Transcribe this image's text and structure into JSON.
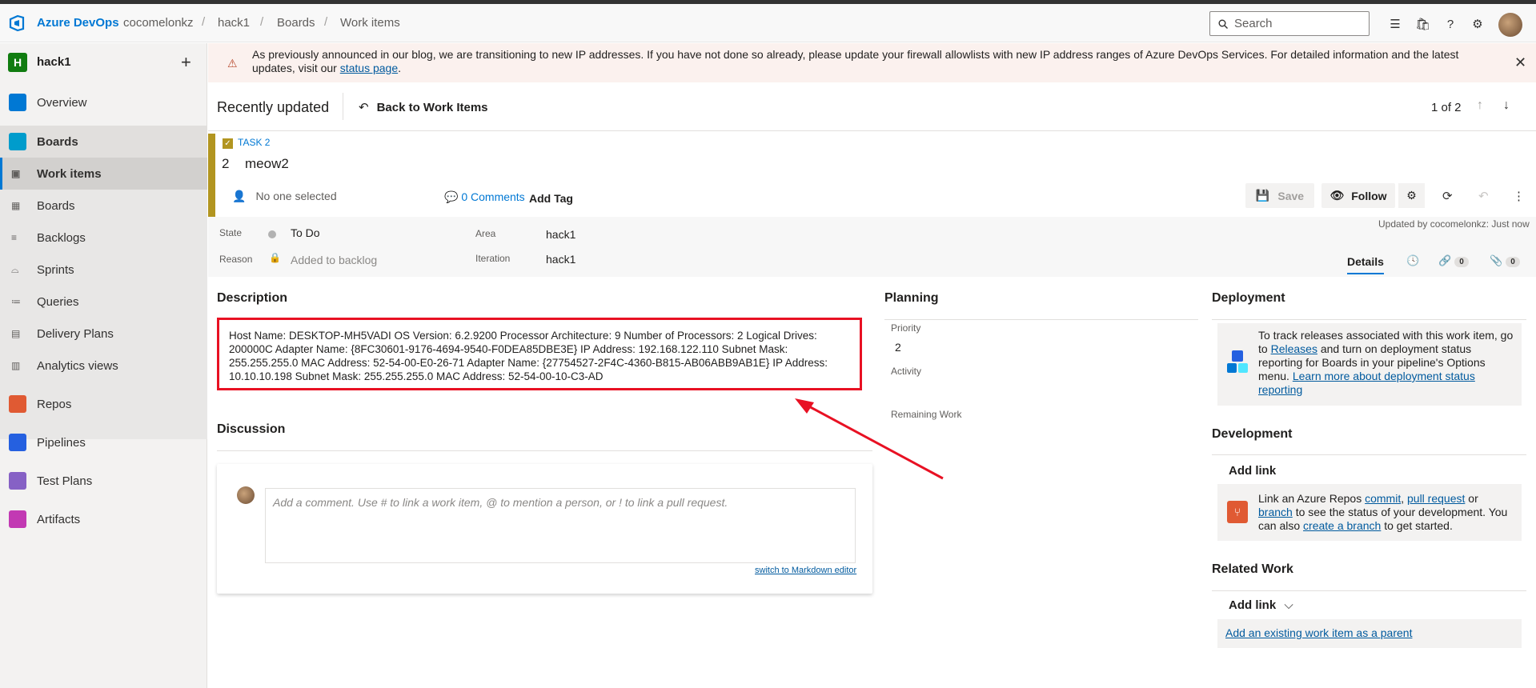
{
  "header": {
    "brand": "Azure DevOps",
    "breadcrumbs": [
      "cocomelonkz",
      "hack1",
      "Boards",
      "Work items"
    ],
    "search_placeholder": "Search"
  },
  "sidebar": {
    "project_initial": "H",
    "project_name": "hack1",
    "items": [
      {
        "label": "Overview",
        "icon": "overview-icon",
        "color": "#0078d4"
      },
      {
        "label": "Boards",
        "icon": "boards-icon",
        "color": "#009ccc"
      },
      {
        "label": "Work items",
        "icon": "work-items-icon"
      },
      {
        "label": "Boards",
        "icon": "board-icon"
      },
      {
        "label": "Backlogs",
        "icon": "backlogs-icon"
      },
      {
        "label": "Sprints",
        "icon": "sprints-icon"
      },
      {
        "label": "Queries",
        "icon": "queries-icon"
      },
      {
        "label": "Delivery Plans",
        "icon": "delivery-plans-icon"
      },
      {
        "label": "Analytics views",
        "icon": "analytics-icon"
      },
      {
        "label": "Repos",
        "icon": "repos-icon",
        "color": "#e05a33"
      },
      {
        "label": "Pipelines",
        "icon": "pipelines-icon",
        "color": "#2560e0"
      },
      {
        "label": "Test Plans",
        "icon": "test-plans-icon",
        "color": "#8661c5"
      },
      {
        "label": "Artifacts",
        "icon": "artifacts-icon",
        "color": "#c239b3"
      }
    ]
  },
  "banner": {
    "text": "As previously announced in our blog, we are transitioning to new IP addresses. If you have not done so already, please update your firewall allowlists with new IP address ranges of Azure DevOps Services. For detailed information and the latest updates, visit our ",
    "link": "status page",
    "suffix": "."
  },
  "toolbar": {
    "recent": "Recently updated",
    "back": "Back to Work Items",
    "pager": "1 of 2"
  },
  "work_item": {
    "type": "TASK 2",
    "id": "2",
    "title": "meow2",
    "assigned": "No one selected",
    "comments": "0 Comments",
    "add_tag": "Add Tag",
    "save": "Save",
    "follow": "Follow",
    "updated": "Updated by cocomelonkz: Just now",
    "state_label": "State",
    "state": "To Do",
    "reason_label": "Reason",
    "reason": "Added to backlog",
    "area_label": "Area",
    "area": "hack1",
    "iteration_label": "Iteration",
    "iteration": "hack1",
    "tab_details": "Details",
    "links_count": "0",
    "attachments_count": "0"
  },
  "description": {
    "title": "Description",
    "text": "Host Name: DESKTOP-MH5VADI OS Version: 6.2.9200 Processor Architecture: 9 Number of Processors: 2 Logical Drives: 200000C Adapter Name: {8FC30601-9176-4694-9540-F0DEA85DBE3E} IP Address: 192.168.122.110 Subnet Mask: 255.255.255.0 MAC Address: 52-54-00-E0-26-71 Adapter Name: {27754527-2F4C-4360-B815-AB06ABB9AB1E} IP Address: 10.10.10.198 Subnet Mask: 255.255.255.0 MAC Address: 52-54-00-10-C3-AD"
  },
  "discussion": {
    "title": "Discussion",
    "placeholder": "Add a comment. Use # to link a work item, @ to mention a person, or ! to link a pull request.",
    "markdown_link": "switch to Markdown editor"
  },
  "planning": {
    "title": "Planning",
    "priority_label": "Priority",
    "priority": "2",
    "activity_label": "Activity",
    "remaining_label": "Remaining Work"
  },
  "deployment": {
    "title": "Deployment",
    "text1": "To track releases associated with this work item, go to ",
    "link1": "Releases",
    "text2": " and turn on deployment status reporting for Boards in your pipeline's Options menu. ",
    "link2": "Learn more about deployment status reporting"
  },
  "development": {
    "title": "Development",
    "add_link": "Add link",
    "text1": "Link an Azure Repos ",
    "link_commit": "commit",
    "sep1": ", ",
    "link_pr": "pull request",
    "text2": " or ",
    "link_branch": "branch",
    "text3": " to see the status of your development. You can also ",
    "link_create": "create a branch",
    "text4": " to get started."
  },
  "related": {
    "title": "Related Work",
    "add_link": "Add link",
    "parent_link": "Add an existing work item as a parent"
  },
  "colors": {
    "accent": "#0078d4",
    "task": "#b29520",
    "highlight": "#e81123"
  }
}
